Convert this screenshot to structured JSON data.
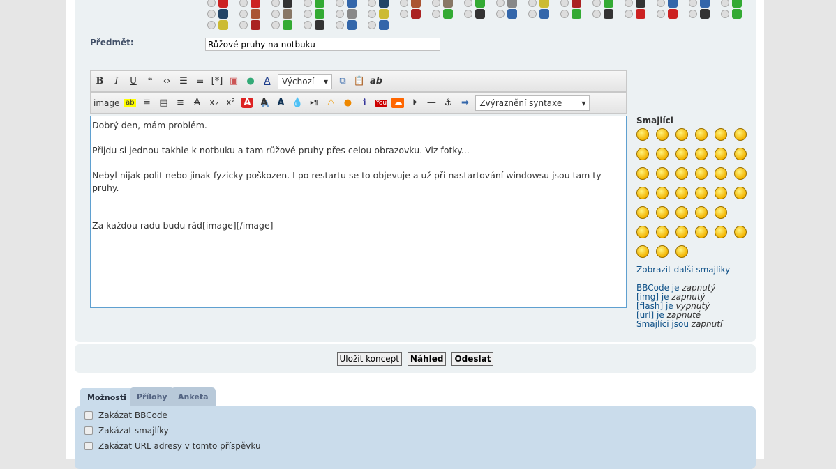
{
  "subject": {
    "label": "Předmět:",
    "value": "Růžové pruhy na notbuku"
  },
  "toolbar1": {
    "items": [
      "B",
      "I",
      "U",
      "quote",
      "code",
      "list",
      "list-numbered",
      "[*]",
      "img",
      "url",
      "color"
    ],
    "font_select": "Výchozí",
    "extra": [
      "copy",
      "paste",
      "ab"
    ]
  },
  "toolbar2": {
    "image_label": "image",
    "items": [
      "highlight",
      "center",
      "left",
      "right",
      "strike",
      "sub",
      "sup",
      "fire",
      "shadow",
      "glow",
      "drop",
      "dir",
      "warning",
      "speech",
      "info",
      "youtube",
      "soundcloud",
      "play",
      "hr",
      "anchor",
      "next"
    ],
    "syntax_select": "Zvýraznění syntaxe"
  },
  "editor": {
    "lines": [
      "Dobrý den, mám problém.",
      "Přijdu si jednou takhle k notbuku a tam růžové pruhy přes celou obrazovku. Viz fotky...",
      "Nebyl nijak polit nebo jinak fyzicky poškozen. I po restartu se to objevuje a už při nastartování windowsu jsou tam ty pruhy.",
      "Za každou radu budu rád[image][/image]"
    ]
  },
  "smilies": {
    "title": "Smajlíci",
    "rows": [
      6,
      6,
      6,
      6,
      5,
      6,
      3
    ],
    "more": "Zobrazit další smajlíky"
  },
  "status": [
    {
      "label": "BBCode je ",
      "value": "zapnutý"
    },
    {
      "label": "[img] je ",
      "value": "zapnutý"
    },
    {
      "label": "[flash] je ",
      "value": "vypnutý"
    },
    {
      "label": "[url] je ",
      "value": "zapnuté"
    },
    {
      "label": "Smajlíci jsou ",
      "value": "zapnutí"
    }
  ],
  "buttons": {
    "draft": "Uložit koncept",
    "preview": "Náhled",
    "submit": "Odeslat"
  },
  "tabs": [
    "Možnosti",
    "Přílohy",
    "Anketa"
  ],
  "options": [
    "Zakázat BBCode",
    "Zakázat smajlíky",
    "Zakázat URL adresy v tomto příspěvku"
  ],
  "colors": {
    "panel": "#ecf1f3",
    "options": "#cadceb",
    "link": "#105289"
  }
}
